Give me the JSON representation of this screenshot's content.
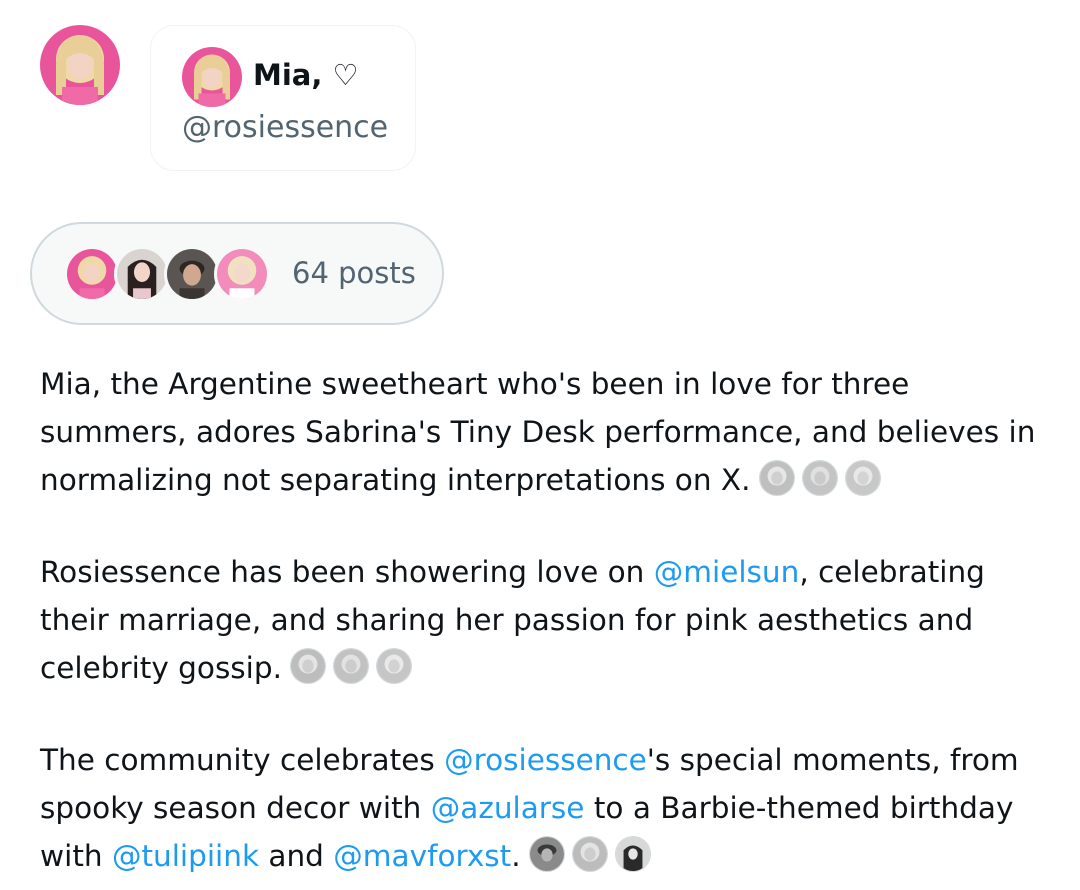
{
  "profile": {
    "display_name": "Mia, ♡",
    "handle": "@rosiessence",
    "avatar_icon": "profile-avatar"
  },
  "posts": {
    "count_label": "64 posts",
    "avatars": [
      "avatar-blonde-pink",
      "avatar-dark-hair",
      "avatar-man",
      "avatar-blonde-pink"
    ]
  },
  "summary": {
    "p1": {
      "text": "Mia, the Argentine sweetheart who's been in love for three summers, adores Sabrina's Tiny Desk performance, and believes in normalizing not separating interpretations on X."
    },
    "p2": {
      "before": "Rosiessence has been showering love on ",
      "mention1": "@mielsun",
      "after": ", celebrating their marriage, and sharing her passion for pink aesthetics and celebrity gossip."
    },
    "p3": {
      "part1": "The community celebrates ",
      "mention1": "@rosiessence",
      "part2": "'s special moments, from spooky season decor with ",
      "mention2": "@azularse",
      "part3": " to a Barbie-themed birthday with ",
      "mention3": "@tulipiink",
      "part4": " and ",
      "mention4": "@mavforxst",
      "part5": "."
    }
  },
  "colors": {
    "link": "#1d9bf0",
    "text": "#0f1419",
    "secondary": "#536471",
    "accent_pink": "#e8559b"
  }
}
